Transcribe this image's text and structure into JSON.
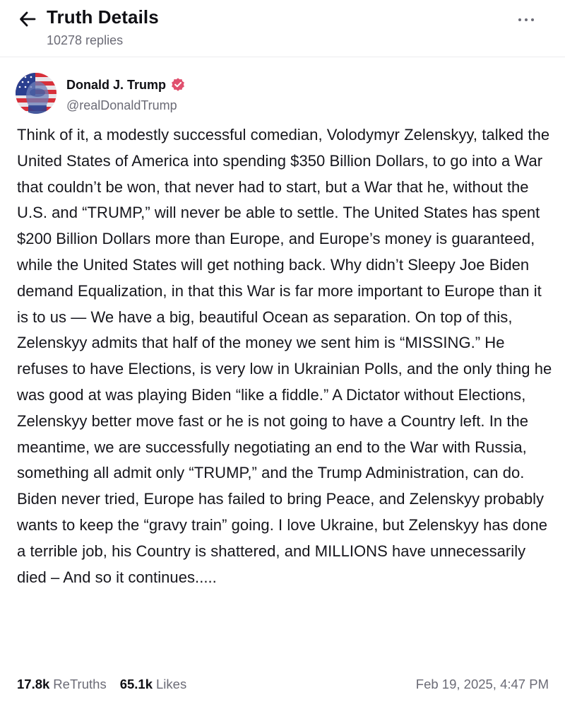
{
  "header": {
    "title": "Truth Details",
    "replies": "10278 replies",
    "back_icon": "arrow-left-icon",
    "more_icon": "more-horizontal-icon"
  },
  "post": {
    "author": {
      "name": "Donald J. Trump",
      "handle": "@realDonaldTrump",
      "verified": true
    },
    "text": "Think of it, a modestly successful comedian, Volodymyr Zelenskyy, talked the United States of America into spending $350 Billion Dollars, to go into a War that couldn’t be won, that never had to start, but a War that he, without the U.S. and “TRUMP,” will never be able to settle. The United States has spent $200 Billion Dollars more than Europe, and Europe’s money is guaranteed, while the United States will get nothing back. Why didn’t Sleepy Joe Biden demand Equalization, in that this War is far more important to Europe than it is to us — We have a big, beautiful Ocean as separation. On top of this, Zelenskyy admits that half of the money we sent him is “MISSING.” He refuses to have Elections, is very low in Ukrainian Polls, and the only thing he was good at was playing Biden “like a fiddle.” A Dictator without Elections, Zelenskyy better move fast or he is not going to have a Country left. In the meantime, we are successfully negotiating an end to the War with Russia, something all admit only “TRUMP,” and the Trump Administration, can do. Biden never tried, Europe has failed to bring Peace, and Zelenskyy probably wants to keep the “gravy train” going. I love Ukraine, but Zelenskyy has done a terrible job, his Country is shattered, and MILLIONS have unnecessarily died – And so it continues.....",
    "stats": {
      "retruths_count": "17.8k",
      "retruths_label": "ReTruths",
      "likes_count": "65.1k",
      "likes_label": "Likes"
    },
    "timestamp": "Feb 19, 2025, 4:47 PM"
  },
  "colors": {
    "text_primary": "#0f0f14",
    "text_secondary": "#6b6b76",
    "verified_badge": "#e0506e"
  }
}
